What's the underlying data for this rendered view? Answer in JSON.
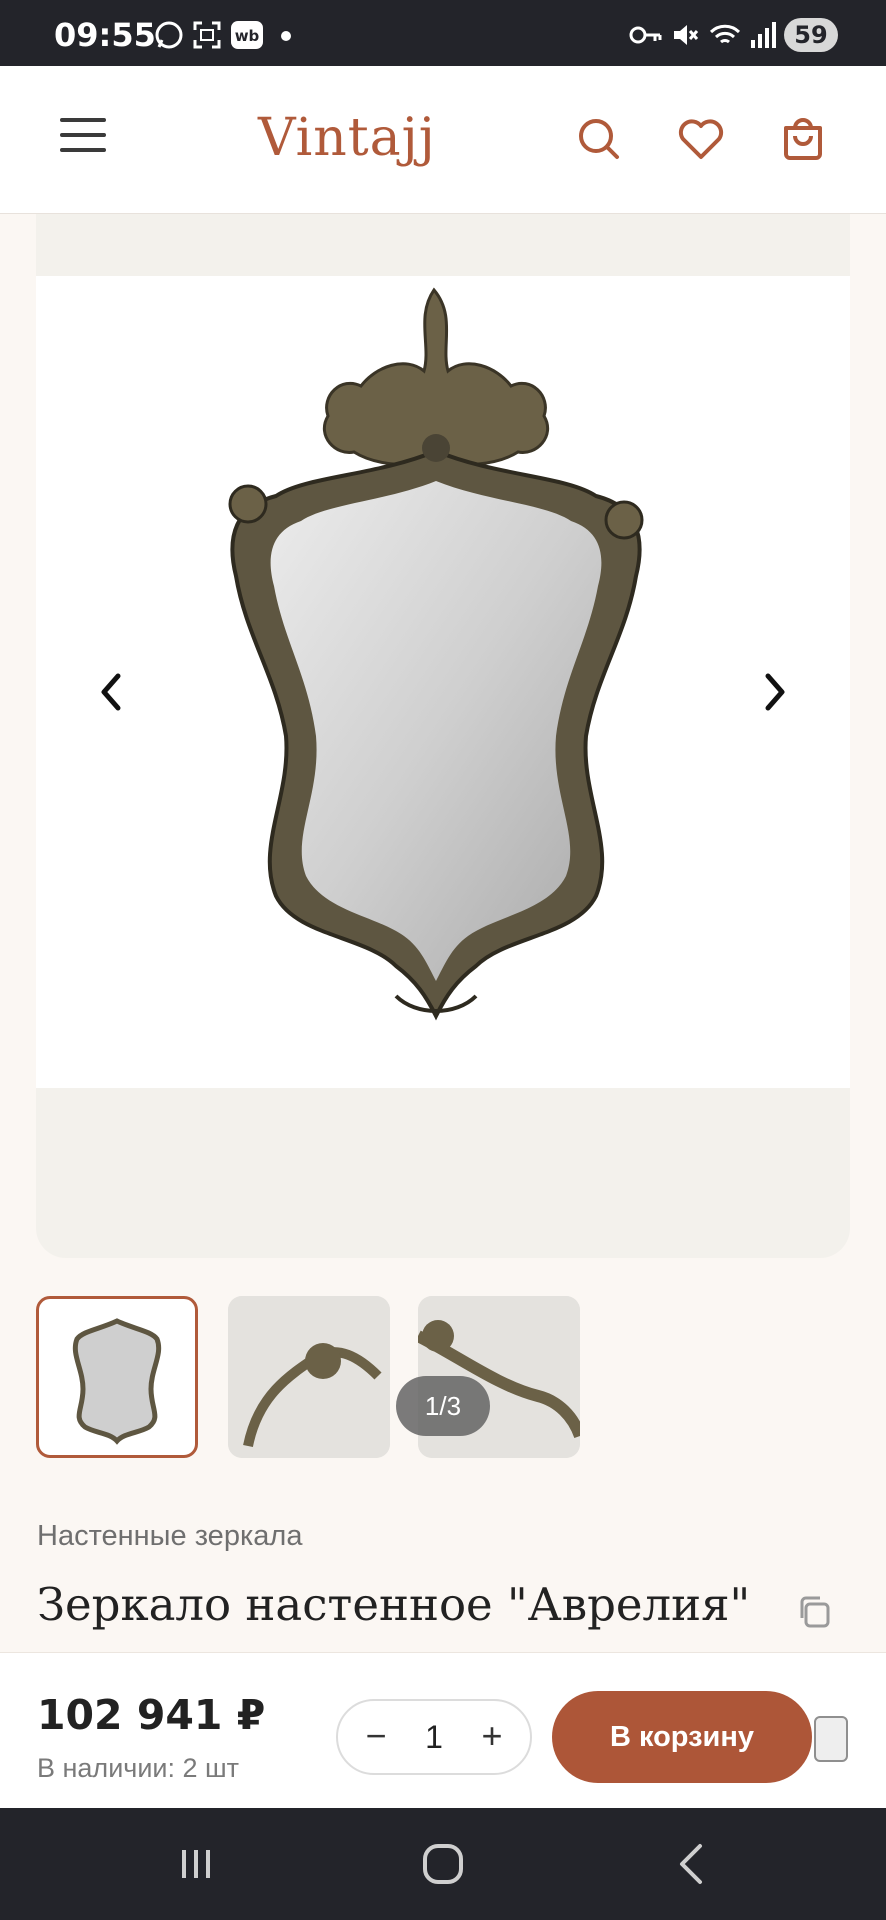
{
  "status_bar": {
    "time": "09:55",
    "battery": "59"
  },
  "header": {
    "logo": "Vintajj",
    "accent_color": "#b05a3a",
    "icons": [
      "menu-icon",
      "search-icon",
      "heart-icon",
      "cart-icon"
    ]
  },
  "gallery": {
    "counter": "1/3",
    "thumbnail_count": 3
  },
  "product": {
    "category": "Настенные зеркала",
    "title": "Зеркало настенное \"Аврелия\""
  },
  "buy": {
    "price": "102 941 ₽",
    "stock": "В наличии: 2 шт",
    "minus": "−",
    "quantity": "1",
    "plus": "+",
    "cart_label": "В корзину",
    "button_color": "#ad5638"
  }
}
